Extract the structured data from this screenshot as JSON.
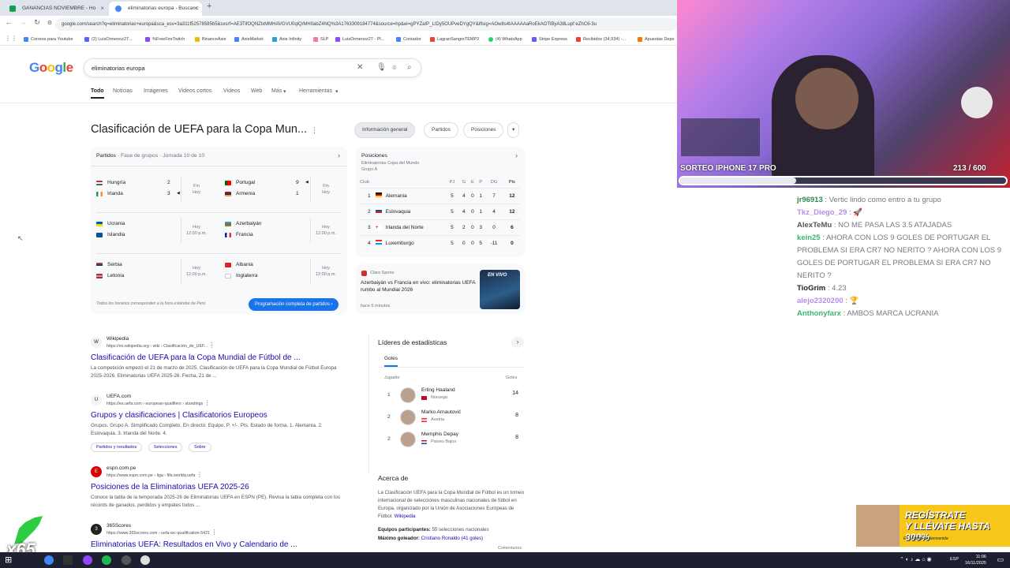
{
  "tabs": [
    {
      "label": "GANANCIAS NOVIEMBRE - Ho"
    },
    {
      "label": "eliminatorias europa - Buscar c"
    }
  ],
  "address": {
    "url": "google.com/search?q=eliminatorias+europa&sca_esv=3a311f52578585b5&sxsrf=AE3TifOQNZlxMMHAVGVU0qlQ/MH0abZ4NQ%3A1763309184774&source=hp&ei=gPYZaIP_LIDy5OUPveDYgQY&iflsig=AOw8s4IAAAAAaRoEkAOTlByA38Lupf eZhC6-3u"
  },
  "bookmarks": [
    "Correos para Youtube",
    "(2) LuisOrmenoz27...",
    "%FreeFireTwitch",
    "BinanceAxie",
    "AxieMarket",
    "Axie Infinity",
    "SLP",
    "LuisOrmenoz27 - Pl...",
    "Contador",
    "LagranSangreTEMP2",
    "(4) WhatsApp",
    "Stripe Express",
    "Recibidos (34,934) -...",
    "Apuestas Depo"
  ],
  "google": {
    "logo": "Google",
    "query": "eliminatorias europa",
    "tabs": [
      "Todo",
      "Noticias",
      "Imágenes",
      "Videos cortos",
      "Videos",
      "Web",
      "Más",
      "Herramientas"
    ]
  },
  "kp": {
    "title": "Clasificación de UEFA para la Copa Mun...",
    "chips": [
      "Información general",
      "Partidos",
      "Posiciones"
    ]
  },
  "matches": {
    "header": "Partidos",
    "subheader": "Fase de grupos · Jornada 10 de 10",
    "games": [
      {
        "home": "Hungría",
        "away": "Irlanda",
        "hs": "2",
        "as": "3",
        "status": "Fin",
        "when": "Hoy"
      },
      {
        "home": "Portugal",
        "away": "Armenia",
        "hs": "9",
        "as": "1",
        "status": "Fin",
        "when": "Hoy"
      },
      {
        "home": "Ucrania",
        "away": "Islandia",
        "hs": "",
        "as": "",
        "status": "Hoy",
        "when": "12:00 p.m."
      },
      {
        "home": "Azerbaiyán",
        "away": "Francia",
        "hs": "",
        "as": "",
        "status": "Hoy",
        "when": "12:00 p.m."
      },
      {
        "home": "Serbia",
        "away": "Letonia",
        "hs": "",
        "as": "",
        "status": "Hoy",
        "when": "12:00 p.m."
      },
      {
        "home": "Albania",
        "away": "Inglaterra",
        "hs": "",
        "as": "",
        "status": "Hoy",
        "when": "12:00 p.m."
      }
    ],
    "footnote": "Todos los horarios corresponden a la hora estándar de Perú",
    "button": "Programación completa de partidos"
  },
  "standings": {
    "header": "Posiciones",
    "sub1": "Eliminatorias Copa del Mundo",
    "sub2": "Grupo A",
    "cols": [
      "Club",
      "PJ",
      "G",
      "E",
      "P",
      "DG",
      "Pts"
    ],
    "rows": [
      [
        "1",
        "Alemania",
        "5",
        "4",
        "0",
        "1",
        "7",
        "12"
      ],
      [
        "2",
        "Eslovaquia",
        "5",
        "4",
        "0",
        "1",
        "4",
        "12"
      ],
      [
        "3",
        "Irlanda del Norte",
        "5",
        "2",
        "0",
        "3",
        "0",
        "6"
      ],
      [
        "4",
        "Luxemburgo",
        "5",
        "0",
        "0",
        "5",
        "-11",
        "0"
      ]
    ]
  },
  "news": {
    "source": "Claro Sports",
    "title": "Azerbaiyán vs Francia en vivo: eliminatorias UEFA rumbo al Mundial 2026",
    "time": "hace 6 minutos",
    "badge": "EN VIVO"
  },
  "results": [
    {
      "site": "Wikipedia",
      "url": "https://es.wikipedia.org › wiki › Clasificación_de_UEF...",
      "title": "Clasificación de UEFA para la Copa Mundial de Fútbol de ...",
      "snippet": "La competición empezó el 21 de marzo de 2025. Clasificación de UEFA para la Copa Mundial de Fútbol Europa 2025-2026. Eliminatorias UEFA 2025-26. Fecha, 21 de ...",
      "fav": "W"
    },
    {
      "site": "UEFA.com",
      "url": "https://es.uefa.com › european-qualifiers › standings",
      "title": "Grupos y clasificaciones | Clasificatorios Europeos",
      "snippet": "Grupos. Grupo A. Simplificado Completo. En directo: Equipo. P. +/-. Pts. Estado de forma. 1. Alemania. 2. Eslovaquia. 3. Irlanda del Norte. 4.",
      "fav": "U",
      "chips": [
        "Partidos y resultados",
        "Selecciones",
        "Sobre"
      ]
    },
    {
      "site": "espn.com.pe",
      "url": "https://www.espn.com.pe › liga › fifa.worldq.uefa",
      "title": "Posiciones de la Eliminatorias UEFA 2025-26",
      "snippet": "Conoce la tabla de la temporada 2025-26 de Eliminatorias UEFA en ESPN (PE). Revisa la tabla completa con los récords de ganados, perdidos y empates todos ...",
      "fav": "E"
    },
    {
      "site": "365Scores",
      "url": "https://www.365scores.com › uefa-wc-qualification-5421",
      "title": "Eliminatorias UEFA: Resultados en Vivo y Calendario de ...",
      "snippet": "",
      "fav": "3"
    }
  ],
  "leaders": {
    "header": "Líderes de estadísticas",
    "tab": "Goles",
    "col_player": "Jugador",
    "col_goals": "Goles",
    "players": [
      {
        "rank": "1",
        "name": "Erling Haaland",
        "country": "Noruega",
        "goals": "14"
      },
      {
        "rank": "2",
        "name": "Marko Arnautović",
        "country": "Austria",
        "goals": "8"
      },
      {
        "rank": "2",
        "name": "Memphis Depay",
        "country": "Países Bajos",
        "goals": "8"
      }
    ]
  },
  "about": {
    "header": "Acerca de",
    "text": "La Clasificación UEFA para la Copa Mundial de Fútbol es un torneo internacional de selecciones masculinas nacionales de fútbol en Europa, organizado por la Unión de Asociaciones Europeas de Fútbol.",
    "link": "Wikipedia",
    "f1_label": "Equipos participantes:",
    "f1_value": "55 selecciones nacionales",
    "f2_label": "Máximo goleador:",
    "f2_value": "Cristiano Ronaldo (41 goles)",
    "comments": "Comentarios"
  },
  "stream": {
    "sorteo": "SORTEO IPHONE 17 PRO",
    "count": "213  / 600",
    "progress": 0.355,
    "chat": [
      {
        "user": "jr96913",
        "text": ": Vertic lindo como entro a tu grupo",
        "color": "#2e8b57"
      },
      {
        "user": "Tkz_Diego_29",
        "text": ": 🚀",
        "color": "#b58de8"
      },
      {
        "user": "AlexTeMu",
        "text": ": NO ME PASA LAS 3.5 ATAJADAS",
        "color": "#555555"
      },
      {
        "user": "kein25",
        "text": ": AHORA CON LOS 9 GOLES DE PORTUGAR EL PROBLEMA SI ERA CR7 NO NERITO ? AHORA CON LOS 9 GOLES DE PORTUGAR EL PROBLEMA SI ERA CR7 NO NERITO ?",
        "color": "#3cb371"
      },
      {
        "user": "TioGrim",
        "text": ": 4.23",
        "color": "#222222"
      },
      {
        "user": "alejo2320200",
        "text": ": 🏆",
        "color": "#b58de8"
      },
      {
        "user": "Anthonyfarx",
        "text": ": AMBOS MARCA UCRANIA",
        "color": "#3cb371"
      }
    ],
    "promo_l1": "REGÍSTRATE",
    "promo_l2": "Y LLÉVATE HASTA 300%",
    "promo_l3": "En tu bono de bienvenida",
    "multiplier": "x65"
  },
  "taskbar": {
    "time": "11:06",
    "date": "16/11/2025",
    "lang": "ESP"
  }
}
